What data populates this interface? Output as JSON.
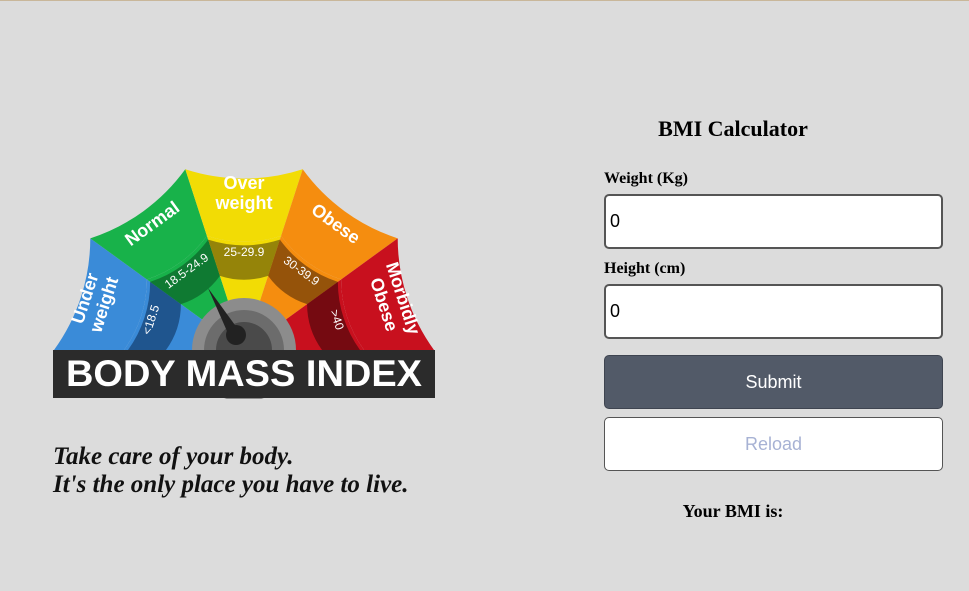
{
  "gauge": {
    "banner_text": "BODY MASS INDEX",
    "categories": [
      {
        "label_line1": "Under",
        "label_line2": "weight",
        "range": "<18.5",
        "outer_color": "#3a8bd8",
        "inner_color": "#1d4f86"
      },
      {
        "label_line1": "Normal",
        "label_line2": "",
        "range": "18.5-24.9",
        "outer_color": "#18b24a",
        "inner_color": "#0e7330"
      },
      {
        "label_line1": "Over",
        "label_line2": "weight",
        "range": "25-29.9",
        "outer_color": "#f2dc05",
        "inner_color": "#8b7a0a"
      },
      {
        "label_line1": "Obese",
        "label_line2": "",
        "range": "30-39.9",
        "outer_color": "#f58d0f",
        "inner_color": "#8b4c0a"
      },
      {
        "label_line1": "Morbidly",
        "label_line2": "Obese",
        "range": ">40",
        "outer_color": "#c8101e",
        "inner_color": "#6b0a0f"
      }
    ]
  },
  "tagline": {
    "line1": "Take care of your body.",
    "line2": "It's the only place you have to live."
  },
  "calculator": {
    "title": "BMI Calculator",
    "weight_label": "Weight (Kg)",
    "weight_value": "0",
    "height_label": "Height (cm)",
    "height_value": "0",
    "submit_label": "Submit",
    "reload_label": "Reload",
    "result_label": "Your BMI is:"
  }
}
